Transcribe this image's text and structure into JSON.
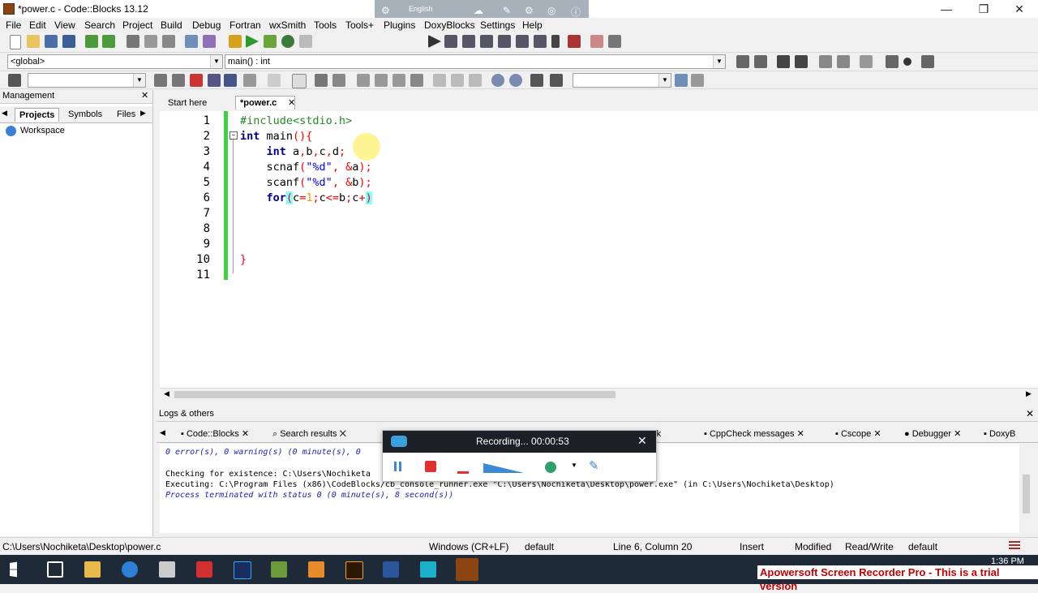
{
  "window": {
    "title": "*power.c - Code::Blocks 13.12",
    "minimize": "—",
    "restore": "❐",
    "close": "✕"
  },
  "overlay": {
    "lang": "English"
  },
  "menu": [
    "File",
    "Edit",
    "View",
    "Search",
    "Project",
    "Build",
    "Debug",
    "Fortran",
    "wxSmith",
    "Tools",
    "Tools+",
    "Plugins",
    "DoxyBlocks",
    "Settings",
    "Help"
  ],
  "scope": {
    "global": "<global>",
    "function": "main() : int"
  },
  "management": {
    "title": "Management",
    "tabs": [
      "Projects",
      "Symbols",
      "Files"
    ],
    "workspace": "Workspace"
  },
  "editor": {
    "tabs": [
      "Start here",
      "*power.c"
    ],
    "line_numbers": [
      "1",
      "2",
      "3",
      "4",
      "5",
      "6",
      "7",
      "8",
      "9",
      "10",
      "11"
    ]
  },
  "logs": {
    "title": "Logs & others",
    "tabs": [
      "Code::Blocks",
      "Search results",
      "CppCheck messages",
      "Cscope",
      "Debugger",
      "DoxyB"
    ],
    "partial_tab": "eck",
    "lines": [
      "0 error(s), 0 warning(s) (0 minute(s), 0",
      "Checking for existence: C:\\Users\\Nochiketa",
      "Executing: C:\\Program Files (x86)\\CodeBlocks/cb_console_runner.exe \"C:\\Users\\Nochiketa\\Desktop\\power.exe\" (in C:\\Users\\Nochiketa\\Desktop)",
      "Process terminated with status 0 (0 minute(s), 8 second(s))"
    ]
  },
  "recorder": {
    "status": "Recording... 00:00:53",
    "close": "✕"
  },
  "status": {
    "path": "C:\\Users\\Nochiketa\\Desktop\\power.c",
    "eol": "Windows (CR+LF)",
    "encoding": "default",
    "position": "Line 6, Column 20",
    "mode": "Insert",
    "modified": "Modified",
    "access": "Read/Write",
    "extra": "default"
  },
  "taskbar": {
    "time": "1:36 PM",
    "trial": "Apowersoft Screen Recorder Pro - This is a trial version"
  },
  "colors": {
    "accent": "#1e2a38",
    "keyword": "#00008b",
    "preprocessor": "#228b22",
    "string": "#0000ff",
    "operator": "#ff0000"
  }
}
